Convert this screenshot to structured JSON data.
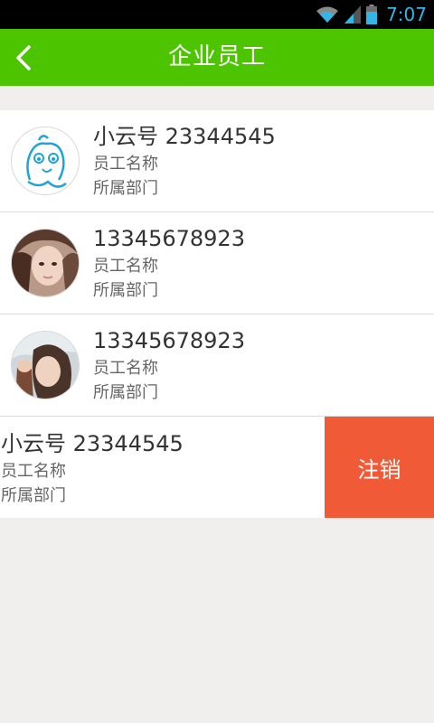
{
  "status_bar": {
    "time": "7:07"
  },
  "header": {
    "title": "企业员工",
    "back_icon": "chevron-left-icon"
  },
  "employees": [
    {
      "name": "小云号 23344545",
      "label": "员工名称",
      "dept": "所属部门",
      "avatar": "cartoon-avatar"
    },
    {
      "name": "13345678923",
      "label": "员工名称",
      "dept": "所属部门",
      "avatar": "photo-avatar"
    },
    {
      "name": "13345678923",
      "label": "员工名称",
      "dept": "所属部门",
      "avatar": "photo-avatar"
    },
    {
      "name": "小云号 23344545",
      "label": "员工名称",
      "dept": "所属部门",
      "action": "注销"
    }
  ],
  "colors": {
    "accent": "#4cc400",
    "delete": "#f15a36",
    "status_time": "#33b5e5"
  }
}
